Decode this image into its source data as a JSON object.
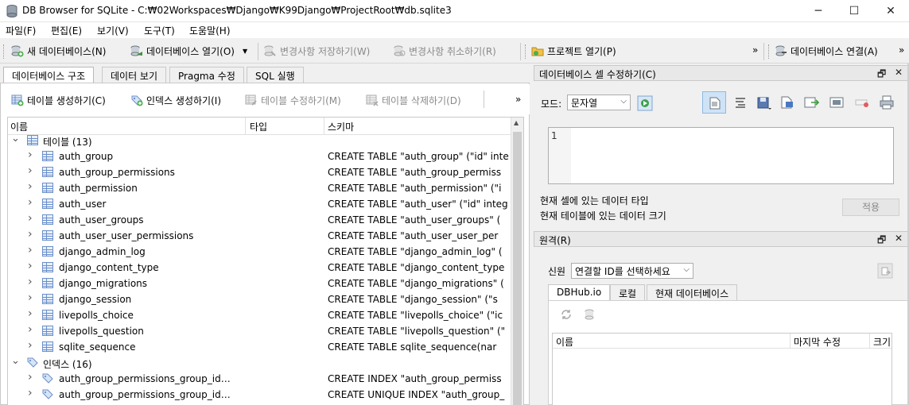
{
  "window": {
    "title": "DB Browser for SQLite - C:₩02Workspaces₩Django₩K99Django₩ProjectRoot₩db.sqlite3",
    "minimize": "─",
    "maximize": "☐",
    "close": "✕"
  },
  "menu": [
    "파일(F)",
    "편집(E)",
    "보기(V)",
    "도구(T)",
    "도움말(H)"
  ],
  "toolbar": {
    "new_db": "새 데이터베이스(N)",
    "open_db": "데이터베이스 열기(O)",
    "write_changes": "변경사항 저장하기(W)",
    "revert_changes": "변경사항 취소하기(R)",
    "open_project": "프로젝트 열기(P)",
    "overflow1": "»",
    "connect_db": "데이터베이스 연결(A)",
    "overflow2": "»"
  },
  "main_tabs": [
    "데이터베이스 구조",
    "데이터 보기",
    "Pragma 수정",
    "SQL 실행"
  ],
  "structure_toolbar": {
    "create_table": "테이블 생성하기(C)",
    "create_index": "인덱스 생성하기(I)",
    "modify_table": "테이블 수정하기(M)",
    "delete_table": "테이블 삭제하기(D)",
    "overflow": "»"
  },
  "tree": {
    "headers": {
      "name": "이름",
      "type": "타입",
      "schema": "스키마"
    },
    "tables_group": "테이블 (13)",
    "tables": [
      {
        "name": "auth_group",
        "schema": "CREATE TABLE \"auth_group\" (\"id\" inte"
      },
      {
        "name": "auth_group_permissions",
        "schema": "CREATE TABLE \"auth_group_permiss"
      },
      {
        "name": "auth_permission",
        "schema": "CREATE TABLE \"auth_permission\" (\"i"
      },
      {
        "name": "auth_user",
        "schema": "CREATE TABLE \"auth_user\" (\"id\" integ"
      },
      {
        "name": "auth_user_groups",
        "schema": "CREATE TABLE \"auth_user_groups\" ("
      },
      {
        "name": "auth_user_user_permissions",
        "schema": "CREATE TABLE \"auth_user_user_per"
      },
      {
        "name": "django_admin_log",
        "schema": "CREATE TABLE \"django_admin_log\" ("
      },
      {
        "name": "django_content_type",
        "schema": "CREATE TABLE \"django_content_type"
      },
      {
        "name": "django_migrations",
        "schema": "CREATE TABLE \"django_migrations\" ("
      },
      {
        "name": "django_session",
        "schema": "CREATE TABLE \"django_session\" (\"s"
      },
      {
        "name": "livepolls_choice",
        "schema": "CREATE TABLE \"livepolls_choice\" (\"ic"
      },
      {
        "name": "livepolls_question",
        "schema": "CREATE TABLE \"livepolls_question\" (\""
      },
      {
        "name": "sqlite_sequence",
        "schema": "CREATE TABLE sqlite_sequence(nar"
      }
    ],
    "indexes_group": "인덱스 (16)",
    "indexes": [
      {
        "name": "auth_group_permissions_group_id…",
        "schema": "CREATE INDEX \"auth_group_permiss"
      },
      {
        "name": "auth_group_permissions_group_id…",
        "schema": "CREATE UNIQUE INDEX \"auth_group_"
      }
    ]
  },
  "edit_cell": {
    "title": "데이터베이스 셀 수정하기(C)",
    "mode_label": "모드:",
    "mode_value": "문자열",
    "line_number": "1",
    "type_info": "현재 셀에 있는 데이터 타입",
    "size_info": "현재 테이블에 있는 데이터 크기",
    "apply": "적용",
    "float_btn": "🗗",
    "close_btn": "✕"
  },
  "remote": {
    "title": "원격(R)",
    "identity_label": "신원",
    "identity_value": "연결할 ID를 선택하세요",
    "tabs": [
      "DBHub.io",
      "로컬",
      "현재 데이터베이스"
    ],
    "headers": {
      "name": "이름",
      "modified": "마지막 수정",
      "size": "크기"
    },
    "float_btn": "🗗",
    "close_btn": "✕"
  }
}
